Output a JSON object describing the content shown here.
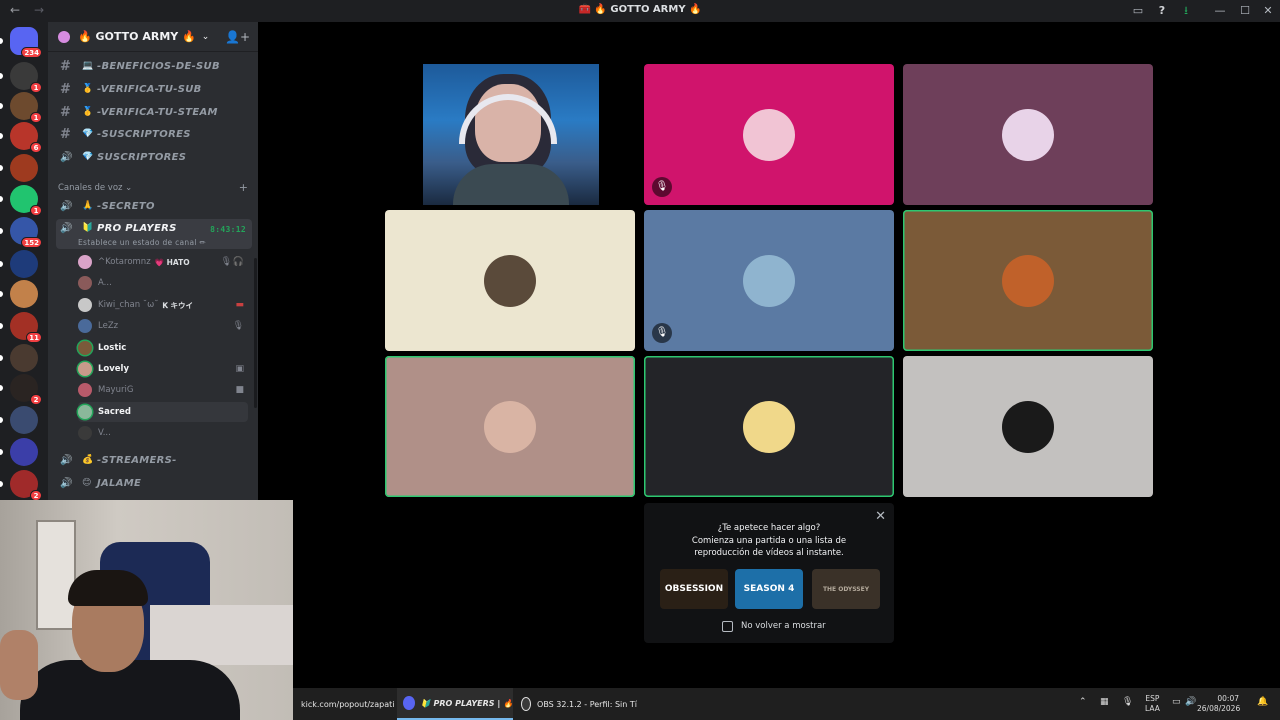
{
  "window": {
    "title": "🧰 🔥 GOTTO ARMY 🔥"
  },
  "rail": {
    "servers": [
      {
        "name": "discord-home",
        "color": "#5865f2",
        "badge": "234"
      },
      {
        "name": "server-1",
        "color": "#3a3a3a",
        "badge": "1"
      },
      {
        "name": "server-2",
        "color": "#6d4a2e",
        "badge": "1"
      },
      {
        "name": "server-3",
        "color": "#b8352a",
        "badge": "6"
      },
      {
        "name": "server-4",
        "color": "#9e3a1f",
        "badge": ""
      },
      {
        "name": "server-5",
        "color": "#21c46f",
        "badge": "1"
      },
      {
        "name": "server-6",
        "color": "#3556a8",
        "badge": "152"
      },
      {
        "name": "server-7",
        "color": "#1e3b7a",
        "badge": ""
      },
      {
        "name": "server-8",
        "color": "#c2814a",
        "badge": ""
      },
      {
        "name": "server-9",
        "color": "#a33025",
        "badge": "11"
      },
      {
        "name": "server-10",
        "color": "#4a3a30",
        "badge": ""
      },
      {
        "name": "server-11",
        "color": "#2a2422",
        "badge": "2"
      },
      {
        "name": "server-12",
        "color": "#3a4b70",
        "badge": ""
      },
      {
        "name": "server-13",
        "color": "#3b3ea8",
        "badge": ""
      },
      {
        "name": "server-14",
        "color": "#a02a2a",
        "badge": "2"
      }
    ]
  },
  "sidebar": {
    "guild_name": "🔥 GOTTO ARMY 🔥",
    "text_channels": [
      {
        "emoji": "💻",
        "name": "-BENEFICIOS-DE-SUB",
        "kind": "text"
      },
      {
        "emoji": "🥇",
        "name": "-VERIFICA-TU-SUB",
        "kind": "text"
      },
      {
        "emoji": "🥇",
        "name": "-VERIFICA-TU-STEAM",
        "kind": "text"
      },
      {
        "emoji": "💎",
        "name": "-SUSCRIPTORES",
        "kind": "text"
      },
      {
        "emoji": "💎",
        "name": "SUSCRIPTORES",
        "kind": "voice"
      }
    ],
    "voice_category": "Canales de voz",
    "voice_channels_top": [
      {
        "emoji": "🙏",
        "name": "-SECRETO"
      }
    ],
    "active_channel": {
      "emoji": "🔰",
      "name": "PRO PLAYERS",
      "timer": "8:43:12",
      "status": "Establece un estado de canal ✏"
    },
    "voice_users": [
      {
        "name": "^Kotaromnz",
        "tag": "💗 HATO",
        "color": "#d9a3c8",
        "style": "dim",
        "icons": [
          "🎙",
          "🎧"
        ]
      },
      {
        "name": "A...",
        "tag": "",
        "color": "#8a5a5a",
        "style": "dim",
        "icons": []
      },
      {
        "name": "Kiwi_chan ˘ω˘",
        "tag": "𝐊 キウイ",
        "color": "#c8c8c8",
        "style": "dim",
        "icons": [
          "▬"
        ]
      },
      {
        "name": "LeZz",
        "tag": "",
        "color": "#4a6a9a",
        "style": "dim",
        "icons": [
          "🎙"
        ]
      },
      {
        "name": "Lostic",
        "tag": "",
        "color": "#7a5a3a",
        "style": "bright",
        "icons": []
      },
      {
        "name": "Lovely",
        "tag": "",
        "color": "#c89a8a",
        "style": "bright",
        "icons": [
          "▣"
        ]
      },
      {
        "name": "MayuriG",
        "tag": "",
        "color": "#b85a6a",
        "style": "dim",
        "icons": [
          "■"
        ]
      },
      {
        "name": "Sacred",
        "tag": "",
        "color": "#8ab89a",
        "style": "bright",
        "icons": []
      },
      {
        "name": "V...",
        "tag": "",
        "color": "#3a3a3a",
        "style": "dim",
        "icons": []
      }
    ],
    "voice_channels_bottom": [
      {
        "emoji": "💰",
        "name": "-STREAMERS-"
      },
      {
        "emoji": "😊",
        "name": "JALAME"
      }
    ]
  },
  "stage": {
    "tiles": [
      {
        "name": "tile-streamer-video",
        "bg": "#000000",
        "video": true,
        "speaking": false,
        "muted": false,
        "avatar": ""
      },
      {
        "name": "tile-kotaromnz",
        "bg": "#d0146c",
        "video": false,
        "speaking": false,
        "muted": true,
        "avatar": "#f1c4d4"
      },
      {
        "name": "tile-mayurig",
        "bg": "#6e3f5a",
        "video": false,
        "speaking": false,
        "muted": false,
        "avatar": "#e8d3e8"
      },
      {
        "name": "tile-kiwi-chan",
        "bg": "#ece6d0",
        "video": false,
        "speaking": false,
        "muted": false,
        "avatar": "#5a4a3a"
      },
      {
        "name": "tile-lezz",
        "bg": "#5b7aa3",
        "video": false,
        "speaking": false,
        "muted": true,
        "avatar": "#8fb4cf"
      },
      {
        "name": "tile-lostic",
        "bg": "#7b5a38",
        "video": false,
        "speaking": true,
        "muted": false,
        "avatar": "#c0612a"
      },
      {
        "name": "tile-lovely",
        "bg": "#b09088",
        "video": false,
        "speaking": true,
        "muted": false,
        "avatar": "#d9b4a4"
      },
      {
        "name": "tile-sacred",
        "bg": "#232428",
        "video": false,
        "speaking": true,
        "muted": false,
        "avatar": "#f0d88a"
      },
      {
        "name": "tile-v",
        "bg": "#c3c1bf",
        "video": false,
        "speaking": false,
        "muted": false,
        "avatar": "#1a1a1a"
      }
    ]
  },
  "activity": {
    "question": "¿Te apetece hacer algo?",
    "description": "Comienza una partida o una lista de reproducción de vídeos al instante.",
    "games": [
      {
        "label": "OBSESSION",
        "bg": "#2a2016"
      },
      {
        "label": "SEASON 4",
        "bg": "#1d6fa8"
      },
      {
        "label": "THE ODYSSEY",
        "bg": "#3a3128"
      }
    ],
    "dont_show": "No volver a mostrar"
  },
  "taskbar": {
    "browser_item": "kick.com/popout/zapati",
    "discord_item": "🔰 PRO PLAYERS | 🔥",
    "obs_item": "OBS 32.1.2 - Perfil: Sin Tí",
    "lang_line1": "ESP",
    "lang_line2": "LAA",
    "time": "00:07",
    "date": "26/08/2026"
  }
}
